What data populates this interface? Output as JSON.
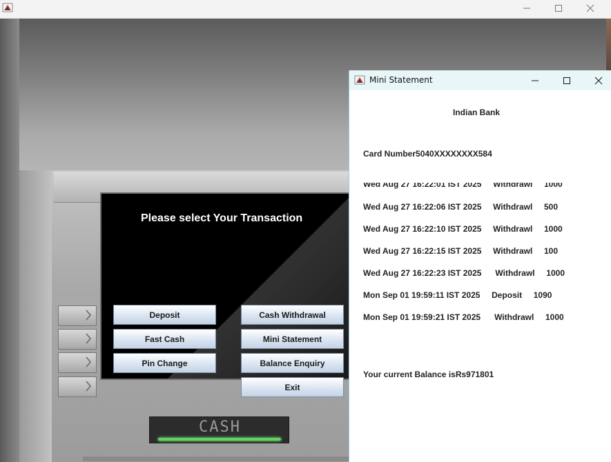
{
  "main_window": {
    "controls": [
      "minimize",
      "maximize",
      "close"
    ]
  },
  "atm": {
    "screen_title": "Please select Your Transaction",
    "buttons": {
      "deposit": "Deposit",
      "cash_withdrawal": "Cash Withdrawal",
      "fast_cash": "Fast Cash",
      "mini_statement": "Mini Statement",
      "pin_change": "Pin Change",
      "balance_enquiry": "Balance Enquiry",
      "exit": "Exit"
    },
    "cash_label": "CASH"
  },
  "mini_statement": {
    "title": "Mini Statement",
    "bank_name": "Indian Bank",
    "card_number": "Card Number5040XXXXXXXX584",
    "transactions": [
      {
        "text": "Wed Aug 27 16:22:01 IST 2025     Withdrawl     1000"
      },
      {
        "text": "Wed Aug 27 16:22:06 IST 2025     Withdrawl     500"
      },
      {
        "text": "Wed Aug 27 16:22:10 IST 2025     Withdrawl     1000"
      },
      {
        "text": "Wed Aug 27 16:22:15 IST 2025     Withdrawl     100"
      },
      {
        "text": "Wed Aug 27 16:22:23 IST 2025      Withdrawl     1000"
      },
      {
        "text": "Mon Sep 01 19:59:11 IST 2025     Deposit     1090"
      },
      {
        "text": "Mon Sep 01 19:59:21 IST 2025      Withdrawl     1000"
      }
    ],
    "balance": "Your current Balance isRs971801"
  },
  "colors": {
    "titlebar_active": "#e8f6f8",
    "button_gradient_top": "#ffffff",
    "button_gradient_bottom": "#c3d3e6",
    "cash_light": "#5fd65f"
  }
}
